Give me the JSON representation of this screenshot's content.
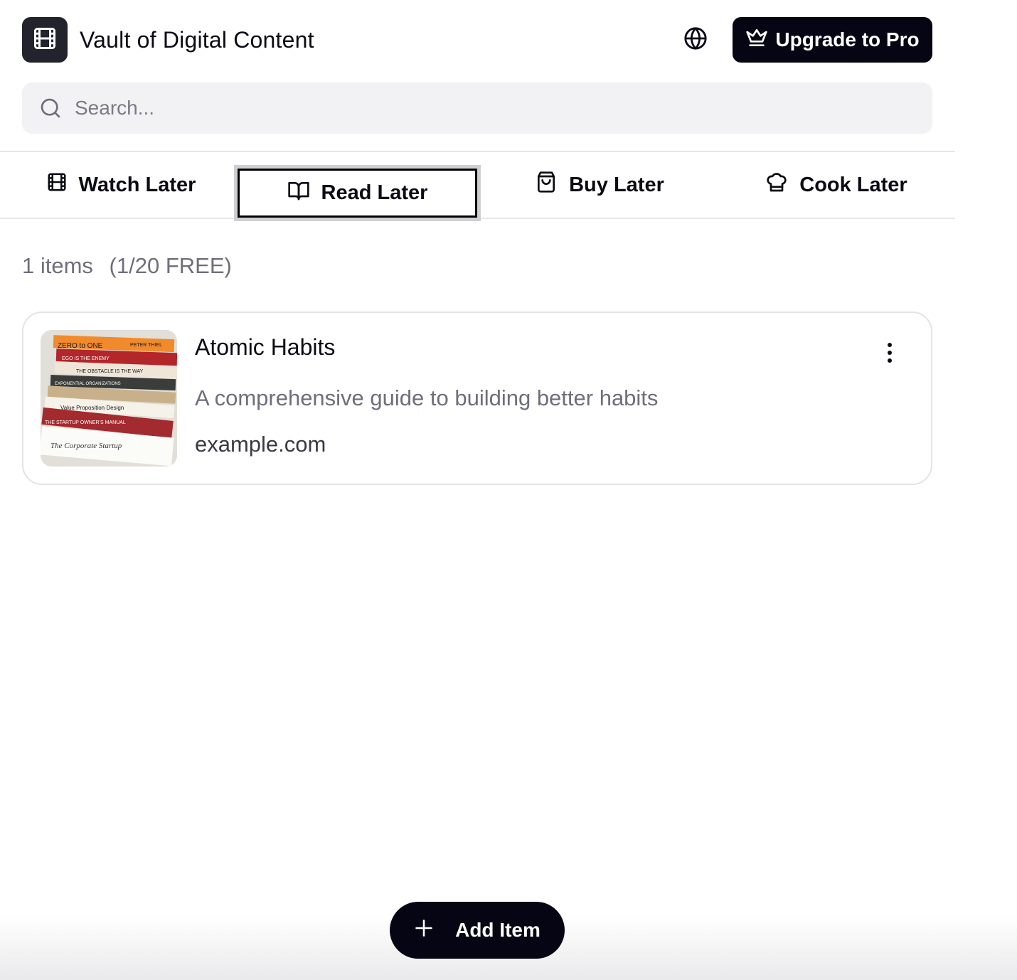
{
  "header": {
    "app_title": "Vault of Digital Content",
    "logo_icon": "film-icon",
    "language_icon": "globe-icon",
    "upgrade_label": "Upgrade to Pro",
    "upgrade_icon": "crown-icon"
  },
  "search": {
    "placeholder": "Search...",
    "value": ""
  },
  "tabs": [
    {
      "label": "Watch Later",
      "icon": "film-icon",
      "active": false
    },
    {
      "label": "Read Later",
      "icon": "book-open-icon",
      "active": true
    },
    {
      "label": "Buy Later",
      "icon": "shopping-bag-icon",
      "active": false
    },
    {
      "label": "Cook Later",
      "icon": "chef-hat-icon",
      "active": false
    }
  ],
  "summary": {
    "items_count": "1 items",
    "quota": "(1/20 FREE)"
  },
  "items": [
    {
      "title": "Atomic Habits",
      "description": "A comprehensive guide to building better habits",
      "domain": "example.com",
      "thumbnail": "book-stack-photo",
      "menu_icon": "more-vertical-icon",
      "thumbnail_texts": [
        "ZERO to ONE",
        "PETER THIEL",
        "EGO IS THE ENEMY",
        "THE OBSTACLE IS THE WAY",
        "EXPONENTIAL ORGANIZATIONS",
        "Value Proposition Design",
        "THE STARTUP OWNER'S MANUAL",
        "The Corporate Startup"
      ]
    }
  ],
  "add_button": {
    "label": "Add Item",
    "icon": "plus-icon"
  },
  "colors": {
    "primary_dark": "#050514",
    "muted_text": "#6e6e7c",
    "search_bg": "#f2f2f4",
    "border": "#e4e4e8"
  }
}
